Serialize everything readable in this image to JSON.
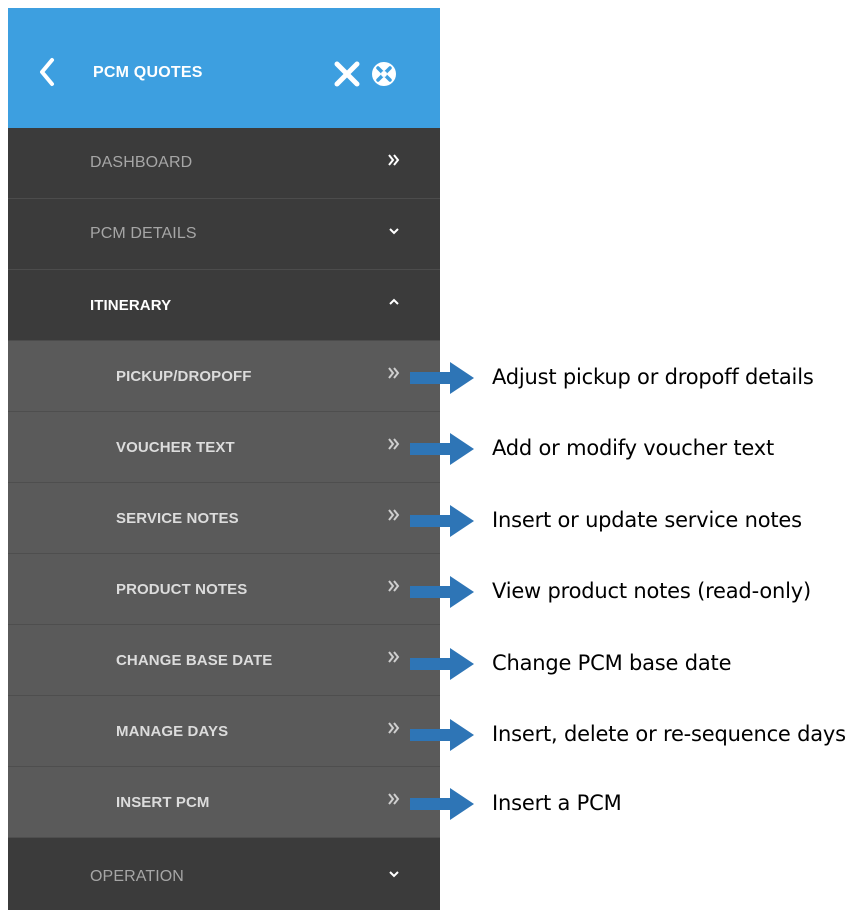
{
  "header": {
    "title": "PCM QUOTES",
    "back_icon": "chevron-left-icon",
    "close_icon": "close-icon",
    "settings_icon": "tools-icon",
    "background_color": "#3d9fe0"
  },
  "nav": {
    "dashboard": {
      "label": "DASHBOARD",
      "icon": "double-chevron-right-icon"
    },
    "pcm_details": {
      "label": "PCM DETAILS",
      "icon": "chevron-down-icon"
    },
    "itinerary": {
      "label": "ITINERARY",
      "icon": "chevron-up-icon",
      "expanded": true
    },
    "operation": {
      "label": "OPERATION",
      "icon": "chevron-down-icon"
    },
    "itinerary_items": [
      {
        "label": "PICKUP/DROPOFF",
        "annotation": "Adjust pickup or dropoff details"
      },
      {
        "label": "VOUCHER TEXT",
        "annotation": "Add or modify voucher text"
      },
      {
        "label": "SERVICE NOTES",
        "annotation": "Insert or update service notes"
      },
      {
        "label": "PRODUCT NOTES",
        "annotation": "View product notes (read-only)"
      },
      {
        "label": "CHANGE BASE DATE",
        "annotation": "Change PCM base date"
      },
      {
        "label": "MANAGE DAYS",
        "annotation": "Insert, delete or re-sequence days"
      },
      {
        "label": "INSERT PCM",
        "annotation": "Insert a PCM"
      }
    ]
  },
  "colors": {
    "panel_dark": "#3b3b3b",
    "panel_sub": "#5a5a5a",
    "arrow_blue": "#2e75b6"
  }
}
